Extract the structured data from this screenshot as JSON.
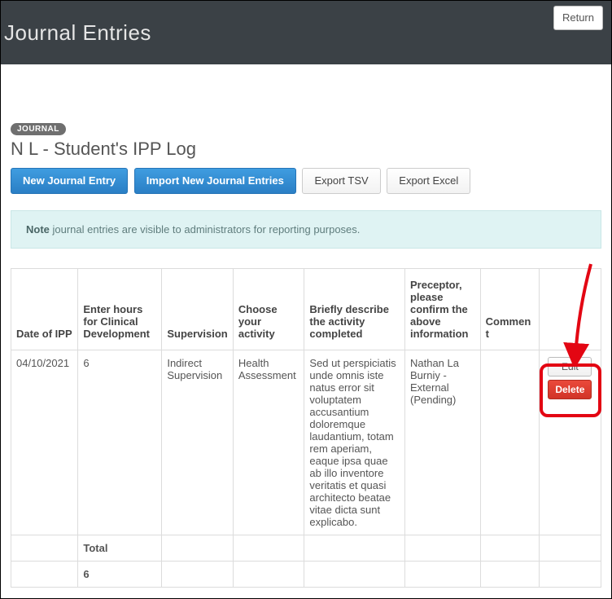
{
  "header": {
    "title": "Journal Entries",
    "return_label": "Return"
  },
  "pill": "JOURNAL",
  "page_title": "N L - Student's IPP Log",
  "actions": {
    "new_entry": "New Journal Entry",
    "import": "Import New Journal Entries",
    "export_tsv": "Export TSV",
    "export_excel": "Export Excel"
  },
  "note": {
    "label": "Note",
    "text": " journal entries are visible to administrators for reporting purposes."
  },
  "columns": {
    "date": "Date of IPP",
    "hours": "Enter hours for Clinical Development",
    "supervision": "Supervision",
    "activity": "Choose your activity",
    "description": "Briefly describe the activity completed",
    "preceptor": "Preceptor, please confirm the above information",
    "comment": "Comment",
    "actions": ""
  },
  "rows": [
    {
      "date": "04/10/2021",
      "hours": "6",
      "supervision": "Indirect Supervision",
      "activity": "Health Assessment",
      "description": "Sed ut perspiciatis unde omnis iste natus error sit voluptatem accusantium doloremque laudantium, totam rem aperiam, eaque ipsa quae ab illo inventore veritatis et quasi architecto beatae vitae dicta sunt explicabo.",
      "preceptor": "Nathan La Burniy - External (Pending)",
      "comment": "",
      "edit_label": "Edit",
      "delete_label": "Delete"
    }
  ],
  "total": {
    "label": "Total",
    "hours": "6"
  }
}
